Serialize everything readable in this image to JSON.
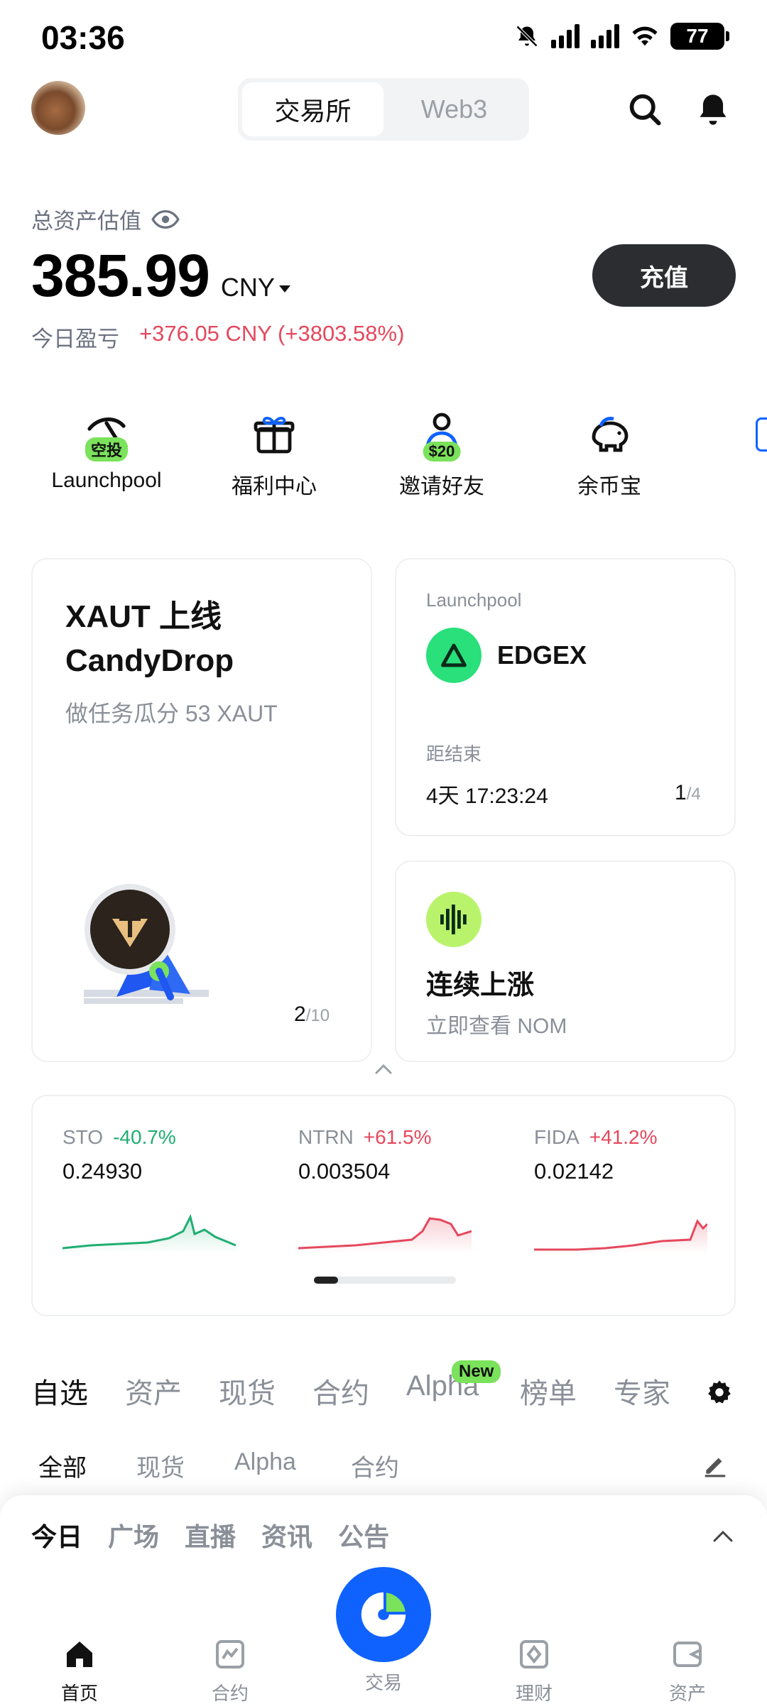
{
  "status": {
    "time": "03:36",
    "battery": "77"
  },
  "header": {
    "seg_exchange": "交易所",
    "seg_web3": "Web3"
  },
  "assets": {
    "label": "总资产估值",
    "value": "385.99",
    "currency": "CNY",
    "pnl_label": "今日盈亏",
    "pnl_value": "+376.05 CNY (+3803.58%)",
    "deposit": "充值"
  },
  "quick": [
    {
      "label": "Launchpool",
      "badge": "空投",
      "icon": "pickaxe-icon"
    },
    {
      "label": "福利中心",
      "icon": "gift-icon"
    },
    {
      "label": "邀请好友",
      "badge": "$20",
      "icon": "user-icon"
    },
    {
      "label": "余币宝",
      "icon": "piggy-bank-icon"
    }
  ],
  "promo": {
    "title_line1": "XAUT 上线",
    "title_line2": "CandyDrop",
    "subtitle": "做任务瓜分 53 XAUT",
    "page_current": "2",
    "page_total": "/10"
  },
  "launchpool": {
    "label": "Launchpool",
    "token": "EDGEX",
    "end_label": "距结束",
    "countdown": "4天 17:23:24",
    "page_current": "1",
    "page_total": "/4"
  },
  "rise": {
    "title": "连续上涨",
    "subtitle": "立即查看 NOM"
  },
  "tickers": [
    {
      "symbol": "STO",
      "change": "-40.7%",
      "price": "0.24930",
      "dir": "down"
    },
    {
      "symbol": "NTRN",
      "change": "+61.5%",
      "price": "0.003504",
      "dir": "up"
    },
    {
      "symbol": "FIDA",
      "change": "+41.2%",
      "price": "0.02142",
      "dir": "up"
    }
  ],
  "tabs": [
    "自选",
    "资产",
    "现货",
    "合约",
    "Alpha",
    "榜单",
    "专家"
  ],
  "tab_new_badge": "New",
  "subtabs": [
    "全部",
    "现货",
    "Alpha",
    "合约"
  ],
  "news_tabs": [
    "今日",
    "广场",
    "直播",
    "资讯",
    "公告"
  ],
  "nav": {
    "home": "首页",
    "futures": "合约",
    "trade": "交易",
    "earn": "理财",
    "assets": "资产"
  },
  "colors": {
    "up": "#e5485d",
    "down": "#1fae72",
    "brand": "#0f62fe",
    "badge": "#7be25b"
  }
}
